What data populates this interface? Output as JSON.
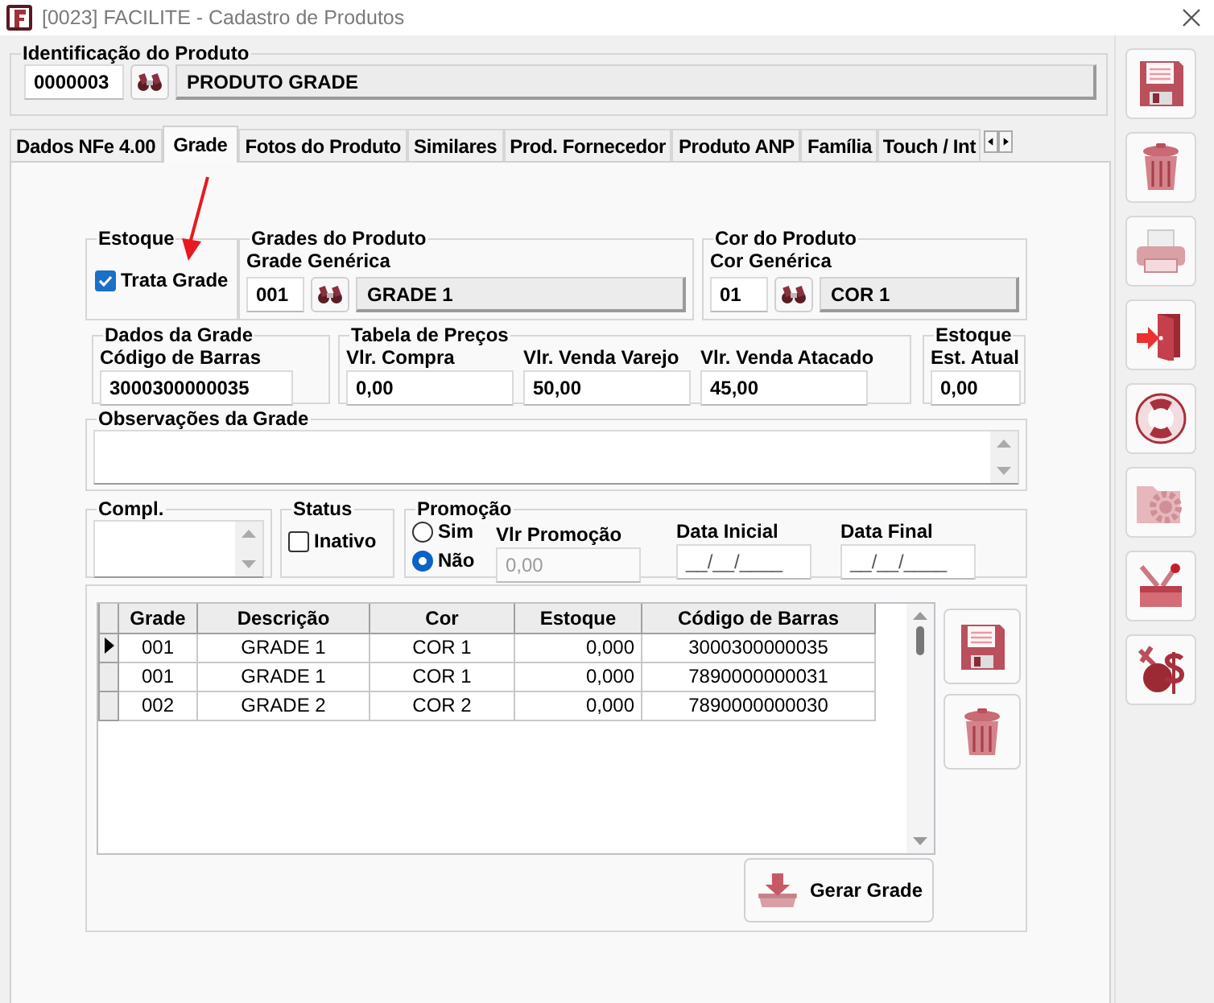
{
  "window": {
    "title": "[0023] FACILITE - Cadastro de Produtos"
  },
  "product": {
    "legend": "Identificação do Produto",
    "code": "0000003",
    "name": "PRODUTO GRADE"
  },
  "tabs": [
    {
      "label": "Dados NFe 4.00",
      "selected": false
    },
    {
      "label": "Grade",
      "selected": true
    },
    {
      "label": "Fotos do Produto",
      "selected": false
    },
    {
      "label": "Similares",
      "selected": false
    },
    {
      "label": "Prod. Fornecedor",
      "selected": false
    },
    {
      "label": "Produto ANP",
      "selected": false
    },
    {
      "label": "Família",
      "selected": false
    },
    {
      "label": "Touch / Int",
      "selected": false
    }
  ],
  "stock_group": {
    "legend": "Estoque",
    "checkbox": {
      "label": "Trata Grade",
      "checked": true
    }
  },
  "grades_group": {
    "legend": "Grades do Produto",
    "label": "Grade Genérica",
    "code": "001",
    "name": "GRADE 1"
  },
  "color_group": {
    "legend": "Cor do Produto",
    "label": "Cor Genérica",
    "code": "01",
    "name": "COR 1"
  },
  "grade_data": {
    "legend": "Dados da Grade",
    "label": "Código de Barras",
    "value": "3000300000035"
  },
  "prices": {
    "legend": "Tabela de Preços",
    "fields": [
      {
        "label": "Vlr. Compra",
        "value": "0,00"
      },
      {
        "label": "Vlr. Venda Varejo",
        "value": "50,00"
      },
      {
        "label": "Vlr. Venda Atacado",
        "value": "45,00"
      }
    ]
  },
  "stock": {
    "legend": "Estoque",
    "label": "Est. Atual",
    "value": "0,00"
  },
  "notes": {
    "legend": "Observações da Grade"
  },
  "compl": {
    "legend": "Compl."
  },
  "status": {
    "legend": "Status",
    "checkbox": {
      "label": "Inativo",
      "checked": false
    }
  },
  "promotion": {
    "legend": "Promoção",
    "options": [
      {
        "label": "Sim",
        "selected": false
      },
      {
        "label": "Não",
        "selected": true
      }
    ],
    "value": {
      "label": "Vlr Promoção",
      "value": "0,00",
      "disabled": true
    },
    "start": {
      "label": "Data Inicial",
      "value": "__/__/____"
    },
    "end": {
      "label": "Data Final",
      "value": "__/__/____"
    }
  },
  "grid": {
    "columns": [
      "Grade",
      "Descrição",
      "Cor",
      "Estoque",
      "Código de Barras"
    ],
    "rows": [
      {
        "selected": true,
        "cells": [
          "001",
          "GRADE 1",
          "COR 1",
          "0,000",
          "3000300000035"
        ]
      },
      {
        "selected": false,
        "cells": [
          "001",
          "GRADE 1",
          "COR 1",
          "0,000",
          "7890000000031"
        ]
      },
      {
        "selected": false,
        "cells": [
          "002",
          "GRADE 2",
          "COR 2",
          "0,000",
          "7890000000030"
        ]
      }
    ]
  },
  "generate_button": {
    "label": "Gerar Grade"
  }
}
